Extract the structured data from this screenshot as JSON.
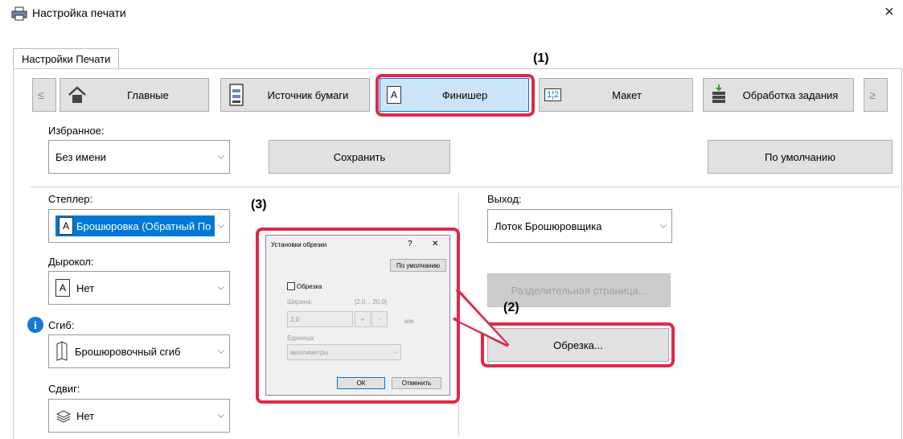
{
  "window": {
    "title": "Настройка печати",
    "close": "×"
  },
  "tab": "Настройки Печати",
  "nav": {
    "prev": "≤",
    "next": "≥",
    "items": [
      "Главные",
      "Источник бумаги",
      "Финишер",
      "Макет",
      "Обработка задания"
    ],
    "active": "Финишер"
  },
  "favorites": {
    "label": "Избранное:",
    "value": "Без имени",
    "save": "Сохранить",
    "default": "По умолчанию"
  },
  "stapler": {
    "label": "Степлер:",
    "value": "Брошюровка (Обратный По"
  },
  "punch": {
    "label": "Дырокол:",
    "value": "Нет"
  },
  "fold": {
    "label": "Сгиб:",
    "value": "Брошюровочный сгиб"
  },
  "offset": {
    "label": "Сдвиг:",
    "value": "Нет"
  },
  "output": {
    "label": "Выход:",
    "value": "Лоток Брошюровщика"
  },
  "separator_btn": "Разделительная страница...",
  "trim_btn": "Обрезка...",
  "callouts": {
    "c1": "(1)",
    "c2": "(2)",
    "c3": "(3)"
  },
  "dialog": {
    "title": "Установки обрезки",
    "help": "?",
    "close": "✕",
    "default_btn": "По умолчанию",
    "trim_checkbox": "Обрезка",
    "width_label": "Ширина:",
    "width_range": "[2,0 .. 20,0]",
    "width_value": "2,0",
    "unit_suffix": "мм.",
    "plus": "+",
    "minus": "-",
    "unit_label": "Единица:",
    "unit_value": "миллиметры",
    "ok": "ОК",
    "cancel": "Отменить"
  },
  "colors": {
    "accent": "#0078d7",
    "callout_red": "#e0284a",
    "info": "#1976d2"
  }
}
